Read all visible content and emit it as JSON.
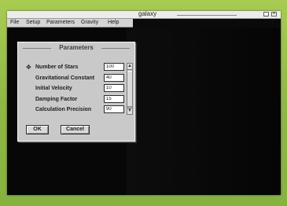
{
  "window": {
    "title": "galaxy",
    "minimize_glyph": "_",
    "close_glyph": "×"
  },
  "menu": {
    "items": [
      "File",
      "Setup",
      "Parameters",
      "Gravity",
      "Help"
    ]
  },
  "dialog": {
    "title": "Parameters",
    "fields": [
      {
        "label": "Number of Stars",
        "value": "100"
      },
      {
        "label": "Gravitational Constant",
        "value": "40"
      },
      {
        "label": "Initial Velocity",
        "value": "10"
      },
      {
        "label": "Damping Factor",
        "value": "15"
      },
      {
        "label": "Calculation Precision",
        "value": "90"
      }
    ],
    "ok_label": "OK",
    "cancel_label": "Cancel"
  },
  "icons": {
    "pointer": "pointer-icon",
    "scroll_up": "▲",
    "scroll_down": "▼"
  },
  "colors": {
    "bezel": "#8fb843",
    "canvas": "#070707",
    "dialog": "#c9c9c9"
  }
}
